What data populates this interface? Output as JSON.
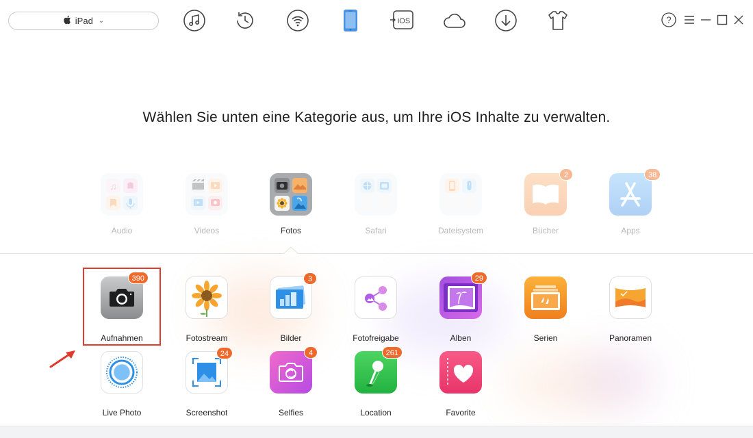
{
  "device": {
    "name": "iPad"
  },
  "toolbar": {
    "icons": [
      "music-icon",
      "history-icon",
      "wifi-icon",
      "device-icon",
      "ios-transfer-icon",
      "cloud-icon",
      "download-icon",
      "tshirt-icon"
    ],
    "ios_label": "iOS"
  },
  "window": {
    "help": "?"
  },
  "headline": "Wählen Sie unten eine Kategorie aus, um Ihre iOS Inhalte zu verwalten.",
  "categories": [
    {
      "label": "Audio"
    },
    {
      "label": "Videos"
    },
    {
      "label": "Fotos",
      "active": true
    },
    {
      "label": "Safari"
    },
    {
      "label": "Dateisystem"
    },
    {
      "label": "Bücher",
      "badge": "2"
    },
    {
      "label": "Apps",
      "badge": "38"
    }
  ],
  "photo_items": [
    {
      "label": "Aufnahmen",
      "badge": "390"
    },
    {
      "label": "Fotostream"
    },
    {
      "label": "Bilder",
      "badge": "3"
    },
    {
      "label": "Fotofreigabe"
    },
    {
      "label": "Alben",
      "badge": "29"
    },
    {
      "label": "Serien"
    },
    {
      "label": "Panoramen"
    },
    {
      "label": "Live Photo"
    },
    {
      "label": "Screenshot",
      "badge": "24"
    },
    {
      "label": "Selfies",
      "badge": "4"
    },
    {
      "label": "Location",
      "badge": "261"
    },
    {
      "label": "Favorite"
    }
  ],
  "colors": {
    "accent": "#4a90e2",
    "badge": "#ee6a2c",
    "highlight": "#e03b2c"
  }
}
